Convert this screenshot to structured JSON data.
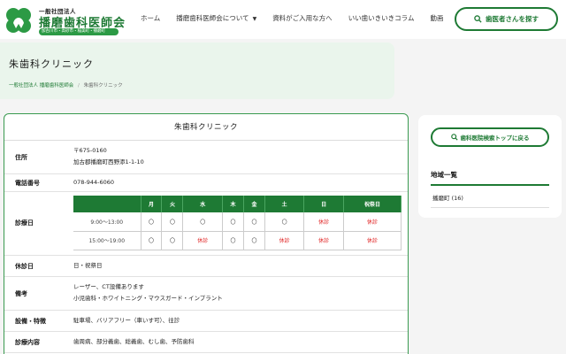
{
  "header": {
    "logo_small": "一般社団法人",
    "logo_main": "播磨歯科医師会",
    "logo_tag": "加古川市・高砂市・稲美町・播磨町",
    "nav": [
      {
        "label": "ホーム"
      },
      {
        "label": "播磨歯科医師会について",
        "caret": "▼"
      },
      {
        "label": "資料がご入用な方へ"
      },
      {
        "label": "いい歯いきいきコラム"
      },
      {
        "label": "動画"
      }
    ],
    "find_button": "歯医者さんを探す"
  },
  "page": {
    "title": "朱歯科クリニック",
    "breadcrumb": [
      "一般社団法人 播磨歯科医師会",
      "/",
      "朱歯科クリニック"
    ]
  },
  "clinic": {
    "name": "朱歯科クリニック",
    "address_label": "住所",
    "postal": "〒675-0160",
    "address": "加古郡播磨町西野添1-1-10",
    "phone_label": "電話番号",
    "phone": "078-944-6060",
    "hours_label": "診療日",
    "hours_table": {
      "headers": [
        "",
        "月",
        "火",
        "水",
        "木",
        "金",
        "土",
        "日",
        "祝祭日"
      ],
      "rows": [
        [
          "9:00～13:00",
          "〇",
          "〇",
          "〇",
          "〇",
          "〇",
          "〇",
          "休診",
          "休診"
        ],
        [
          "15:00～19:00",
          "〇",
          "〇",
          "休診",
          "〇",
          "〇",
          "休診",
          "休診",
          "休診"
        ]
      ]
    },
    "closed_label": "休診日",
    "closed": "日・祝祭日",
    "notes_label": "備考",
    "notes_1": "レーザー、CT設備あります",
    "notes_2": "小児歯科・ホワイトニング・マウスガード・インプラント",
    "facilities_label": "設備・特徴",
    "facilities": "駐車場、バリアフリー（車いす可）、往診",
    "treatment_label": "診療内容",
    "treatment": "歯周病、部分義歯、総義歯、むし歯、予防歯科"
  },
  "sidebar": {
    "search_top_button": "歯科医院検索トップに戻る",
    "area_heading": "地域一覧",
    "area_item": "播磨町 (16)"
  },
  "colors": {
    "brand_green": "#1e7a34",
    "closed_red": "#e02020",
    "title_band": "#eaf5ec"
  }
}
